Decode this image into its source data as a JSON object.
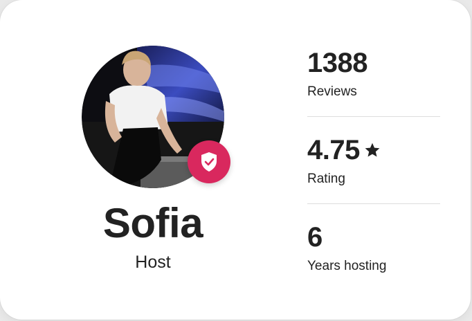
{
  "host": {
    "name": "Sofia",
    "role": "Host",
    "verified": true
  },
  "stats": [
    {
      "value": "1388",
      "label": "Reviews",
      "icon": null
    },
    {
      "value": "4.75",
      "label": "Rating",
      "icon": "star-icon"
    },
    {
      "value": "6",
      "label": "Years hosting",
      "icon": null
    }
  ],
  "colors": {
    "badge": "#d9285e",
    "text": "#222222",
    "divider": "#dddddd"
  }
}
